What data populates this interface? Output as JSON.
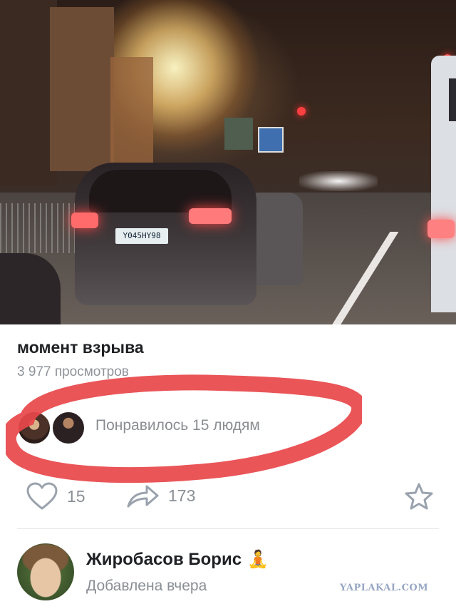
{
  "video": {
    "plate_text": "Y045HY98"
  },
  "post": {
    "title": "момент взрыва",
    "views_text": "3 977 просмотров"
  },
  "likes": {
    "text": "Понравилось 15 людям"
  },
  "actions": {
    "like_count": "15",
    "share_count": "173",
    "icons": [
      "heart-icon",
      "share-icon",
      "star-icon"
    ]
  },
  "author": {
    "name": "Жиробасов Борис",
    "emoji": "🧘",
    "date": "Добавлена вчера"
  },
  "watermark": "YAPLAKAL.COM",
  "colors": {
    "annotation": "#e8464a",
    "secondary_text": "#8a8f96",
    "primary_text": "#1f2124"
  }
}
